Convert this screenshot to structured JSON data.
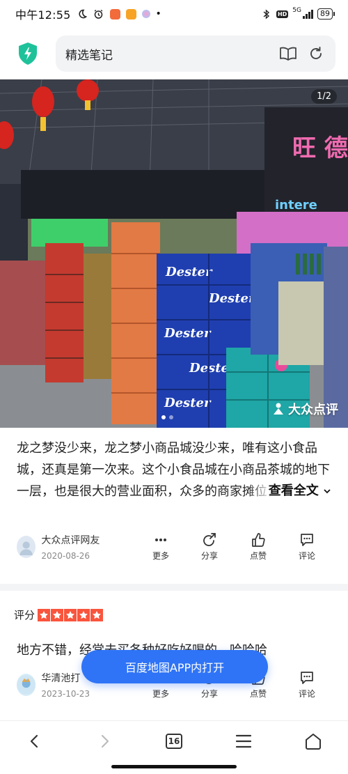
{
  "status_bar": {
    "time": "中午12:55",
    "network": "5G",
    "battery": "89"
  },
  "top_bar": {
    "title": "精选笔记"
  },
  "photo": {
    "counter": "1/2",
    "watermark": "大众点评",
    "slides": 2,
    "active_slide": 1
  },
  "review1": {
    "text": "龙之梦没少来，龙之梦小商品城没少来，唯有这小食品城，还真是第一次来。这个小食品城在小商品茶城的地下一层，也是很大的营业面积，众多的商家摊位，经营品种很全，这次主要冲着调味品和小食品去",
    "read_more": "查看全文",
    "user": "大众点评网友",
    "date": "2020-08-26"
  },
  "actions": {
    "more": "更多",
    "share": "分享",
    "like": "点赞",
    "comment": "评论"
  },
  "review2": {
    "rating_label": "评分",
    "rating": 5,
    "text": "地方不错，经常去买各种好吃好喝的，哈哈哈",
    "user": "华清池打",
    "date": "2023-10-23"
  },
  "open_app_button": "百度地图APP内打开",
  "bottom_nav": {
    "tabs_count": "16"
  },
  "colors": {
    "accent": "#2f74f6",
    "star": "#f9553d",
    "shield": "#1ec29a"
  }
}
